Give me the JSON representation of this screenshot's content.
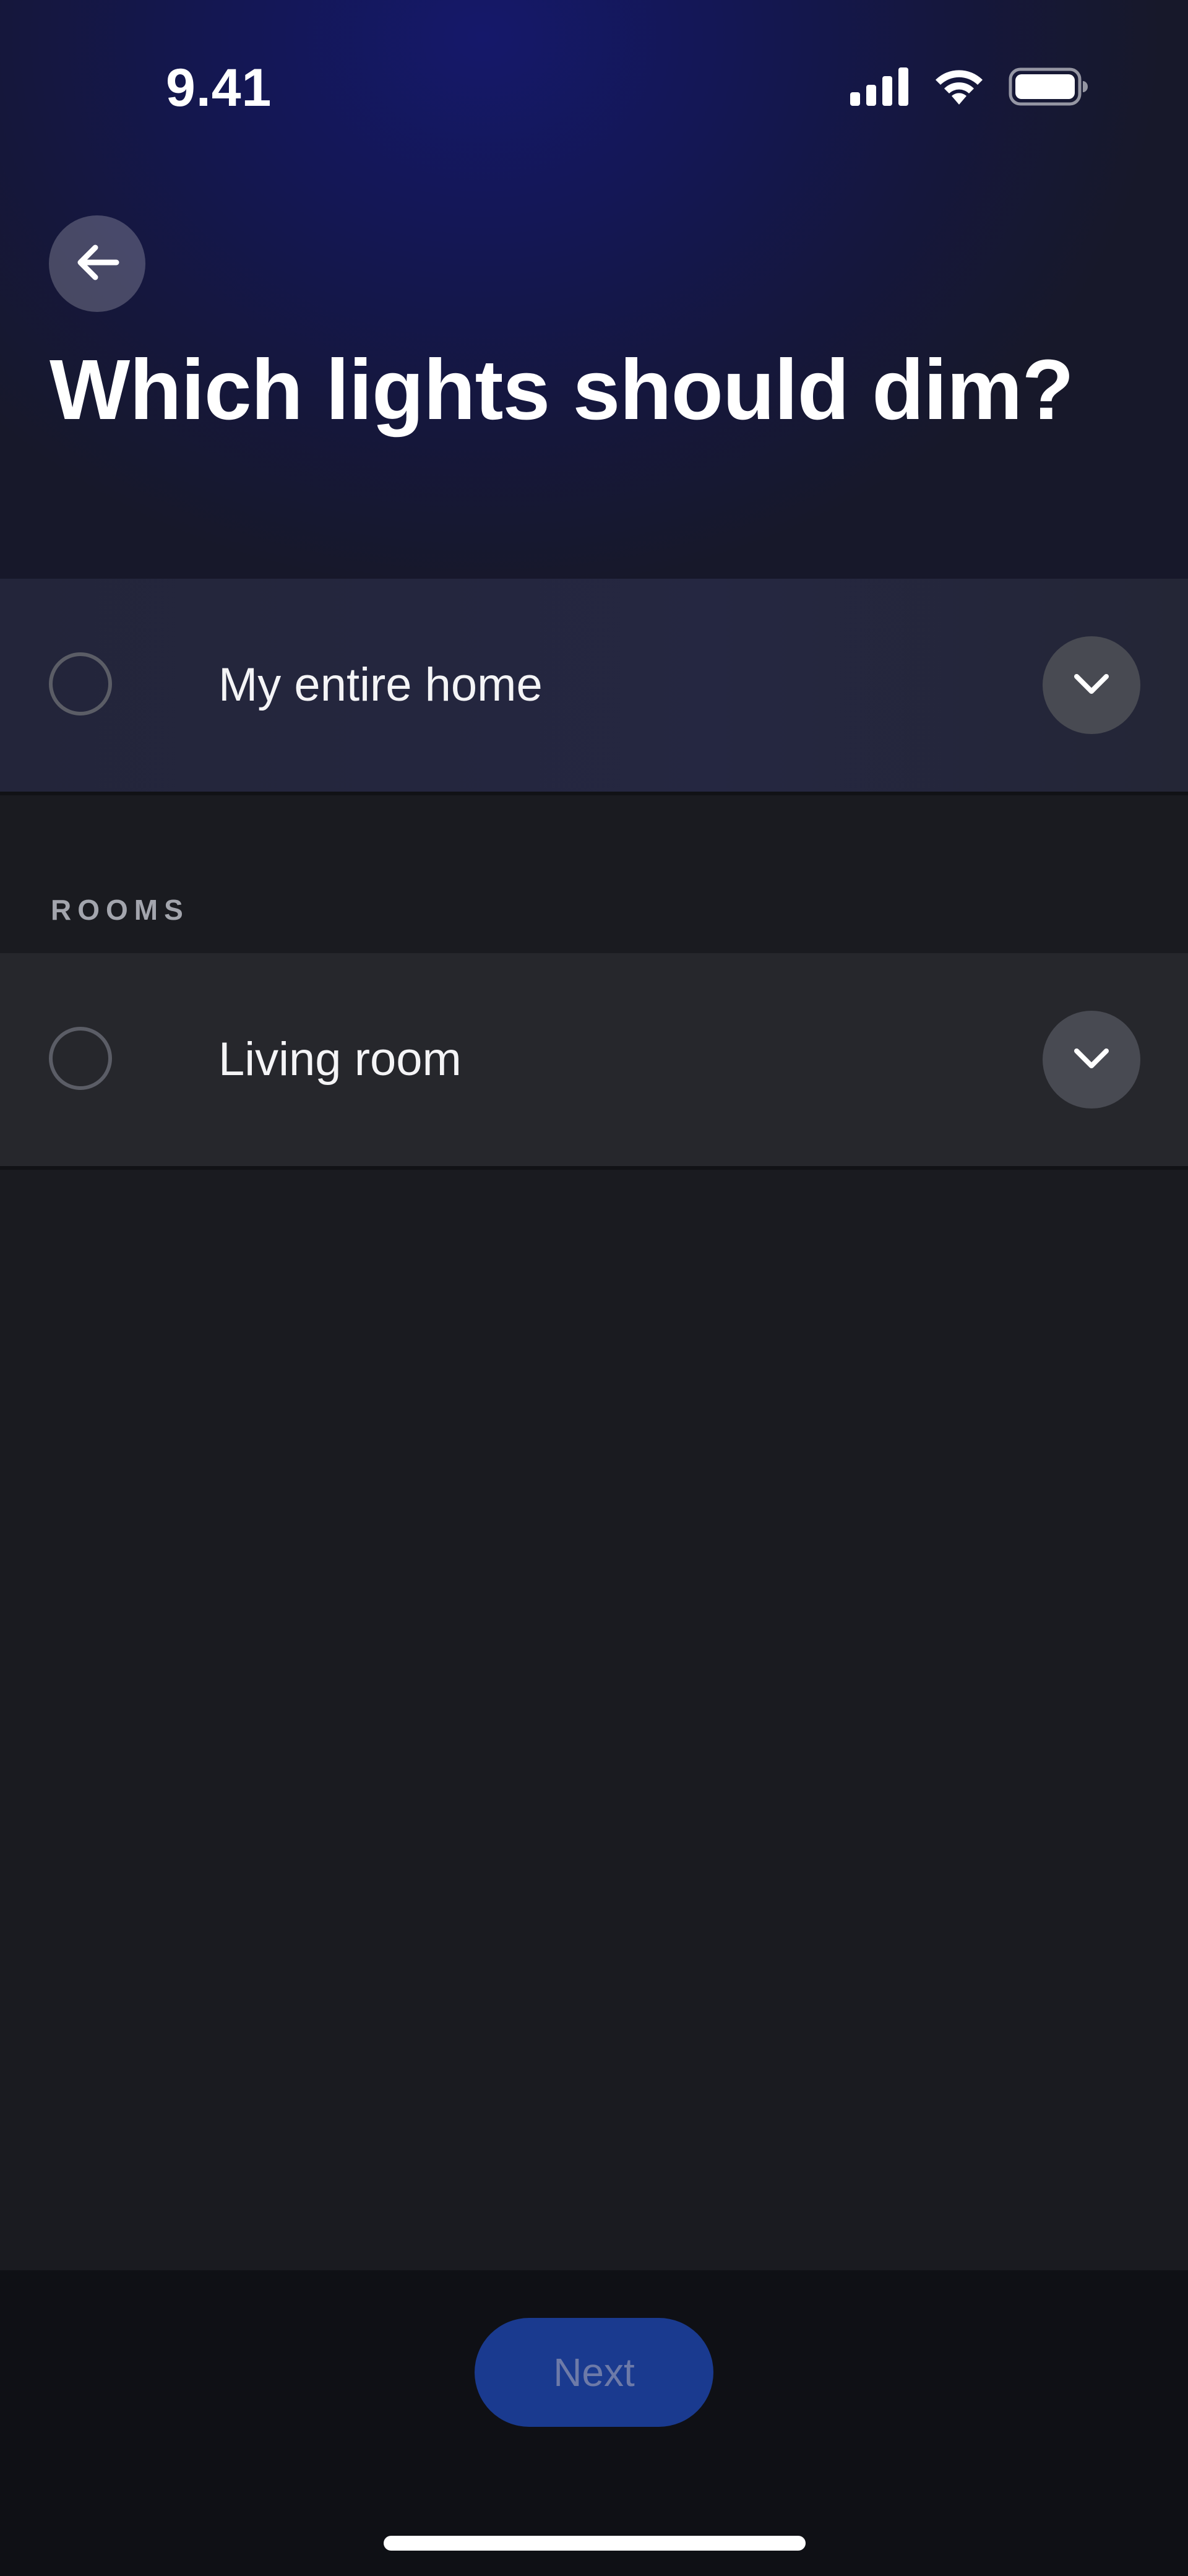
{
  "status_bar": {
    "time": "9.41",
    "icons": [
      "cellular-signal-icon",
      "wifi-icon",
      "battery-icon"
    ]
  },
  "header": {
    "back_icon": "arrow-left-icon",
    "title": "Which lights should dim?"
  },
  "options": {
    "entire_home": {
      "label": "My entire home",
      "selected": false,
      "expand_icon": "chevron-down-icon"
    },
    "rooms_section_label": "ROOMS",
    "rooms": [
      {
        "label": "Living room",
        "selected": false,
        "expand_icon": "chevron-down-icon"
      }
    ]
  },
  "footer": {
    "next_label": "Next",
    "next_enabled": false
  },
  "colors": {
    "header_gradient": "#15186a",
    "background": "#1a1b20",
    "row_background": "#26272c",
    "next_button": "#1a3a8f",
    "next_text_disabled": "#6d7aa8"
  }
}
